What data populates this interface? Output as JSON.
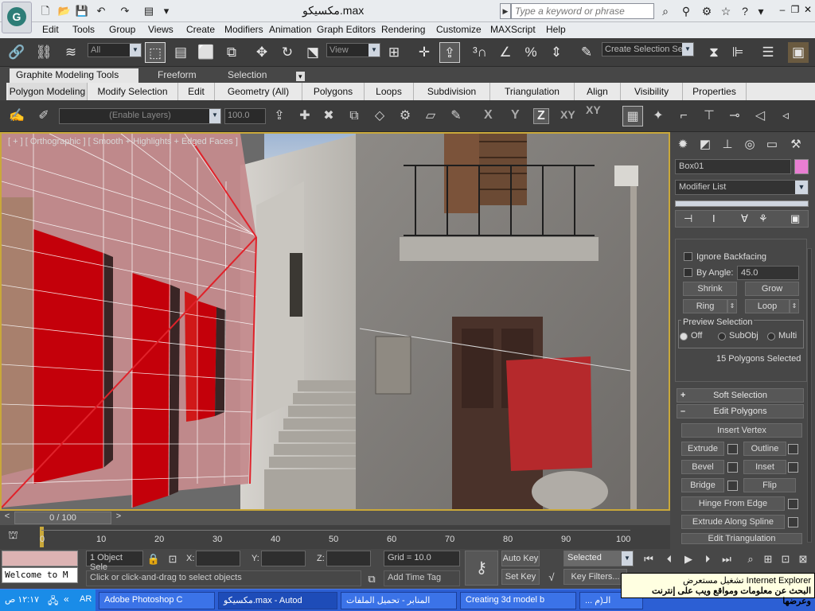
{
  "title_bar": {
    "title": "مكسيكو.max",
    "search_placeholder": "Type a keyword or phrase",
    "app_logo": "G"
  },
  "menu": [
    "Edit",
    "Tools",
    "Group",
    "Views",
    "Create",
    "Modifiers",
    "Animation",
    "Graph Editors",
    "Rendering",
    "Customize",
    "MAXScript",
    "Help"
  ],
  "main_toolbar": {
    "selection_filter": "All",
    "ref_coord": "View",
    "create_selection_set": "Create Selection Se"
  },
  "ribbon": {
    "tabs": [
      "Graphite Modeling Tools",
      "Freeform",
      "Selection"
    ],
    "active_tab": "Graphite Modeling Tools",
    "panels": [
      "Polygon Modeling",
      "Modify Selection",
      "Edit",
      "Geometry (All)",
      "Polygons",
      "Loops",
      "Subdivision",
      "Triangulation",
      "Align",
      "Visibility",
      "Properties"
    ],
    "layer_dropdown": "(Enable Layers)",
    "spinner_value": "100.0",
    "axes": [
      "X",
      "Y",
      "Z",
      "XY",
      "XY"
    ]
  },
  "viewport": {
    "label": "[ + ] [ Orthographic ] [ Smooth + Highlights + Edged Faces ]"
  },
  "command_panel": {
    "object_name": "Box01",
    "object_color": "#e97ed2",
    "modifier_list": "Modifier List",
    "ignore_backfacing": "Ignore Backfacing",
    "by_angle": "By Angle:",
    "by_angle_value": "45.0",
    "shrink": "Shrink",
    "grow": "Grow",
    "ring": "Ring",
    "loop": "Loop",
    "preview_selection": "Preview Selection",
    "preview_options": [
      "Off",
      "SubObj",
      "Multi"
    ],
    "selection_status": "15 Polygons Selected",
    "soft_selection": "Soft Selection",
    "edit_polygons": "Edit Polygons",
    "insert_vertex": "Insert Vertex",
    "extrude": "Extrude",
    "outline": "Outline",
    "bevel": "Bevel",
    "inset": "Inset",
    "bridge": "Bridge",
    "flip": "Flip",
    "hinge_from_edge": "Hinge From Edge",
    "extrude_along_spline": "Extrude Along Spline",
    "edit_triangulation": "Edit Triangulation"
  },
  "timeline": {
    "frame_readout": "0 / 100",
    "ticks": [
      "0",
      "10",
      "20",
      "30",
      "40",
      "50",
      "60",
      "70",
      "80",
      "90",
      "100"
    ]
  },
  "status": {
    "selection_count": "1 Object Sele",
    "x_label": "X:",
    "y_label": "Y:",
    "z_label": "Z:",
    "grid": "Grid = 10.0",
    "prompt": "Click or click-and-drag to select objects",
    "add_time_tag": "Add Time Tag",
    "auto_key": "Auto Key",
    "set_key": "Set Key",
    "key_mode": "Selected",
    "key_filters": "Key Filters...",
    "maxscript": "Welcome to M"
  },
  "taskbar": {
    "time": "١٢:١٧ ص",
    "tasks": [
      "Adobe Photoshop C",
      "مكسيكو.max - Autod",
      "المنابر - تحميل الملفات",
      "Creating 3d model b",
      "... الـ(م"
    ],
    "balloon_line1": "تشغيل مستعرض Internet Explorer",
    "balloon_line2": "البحث عن معلومات ومواقع ويب على إنترنت وعرضها"
  },
  "colors": {
    "accent": "#c9a83a",
    "selected_faces": "#c4000a",
    "taskbar": "#2c5fd4"
  }
}
